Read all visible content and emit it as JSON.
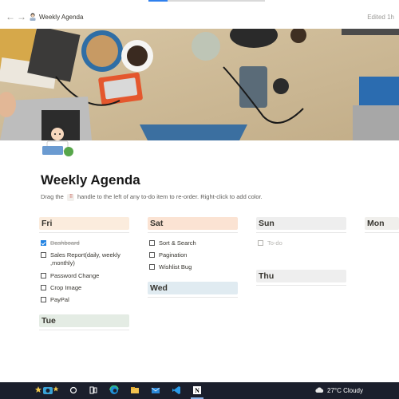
{
  "topbar": {
    "back_icon": "arrow-left-icon",
    "forward_icon": "arrow-right-icon",
    "breadcrumb": "Weekly Agenda",
    "edited": "Edited 1h"
  },
  "page": {
    "title": "Weekly Agenda",
    "hint_before": "Drag the",
    "handle_glyph": "⠿",
    "hint_after": "handle to the left of any to-do item to re-order. Right-click to add color."
  },
  "columns": [
    {
      "day": "Fri",
      "color": "#fbecdd",
      "items": [
        {
          "text": "Dashboard",
          "checked": true
        },
        {
          "text": "Sales Report(daily, weekly",
          "checked": false
        },
        {
          "text": ",monthly)",
          "checked": null
        },
        {
          "text": "Password Change",
          "checked": false
        },
        {
          "text": "Crop Image",
          "checked": false
        },
        {
          "text": "PayPal",
          "checked": false
        }
      ]
    },
    {
      "day": "Sat",
      "color": "#fbe3d3",
      "items": [
        {
          "text": "Sort & Search",
          "checked": false
        },
        {
          "text": "Pagination",
          "checked": false
        },
        {
          "text": "Wishlist Bug",
          "checked": false
        }
      ]
    },
    {
      "day": "Sun",
      "color": "#eeeeee",
      "items": [
        {
          "text": "To-do",
          "checked": false,
          "placeholder": true
        }
      ]
    },
    {
      "day": "Mon",
      "color": "#f0efec",
      "items": []
    },
    {
      "day": "Tue",
      "color": "#e4ece4",
      "items": []
    },
    {
      "day": "Wed",
      "color": "#e0ebf1",
      "items": []
    },
    {
      "day": "Thu",
      "color": "#eeeeee",
      "items": []
    }
  ],
  "taskbar": {
    "weather": "27°C  Cloudy",
    "icons": [
      "widgets-icon",
      "search-icon",
      "task-view-icon",
      "edge-icon",
      "file-explorer-icon",
      "mail-icon",
      "vscode-icon",
      "notion-icon",
      "weather-cloud-icon"
    ]
  }
}
